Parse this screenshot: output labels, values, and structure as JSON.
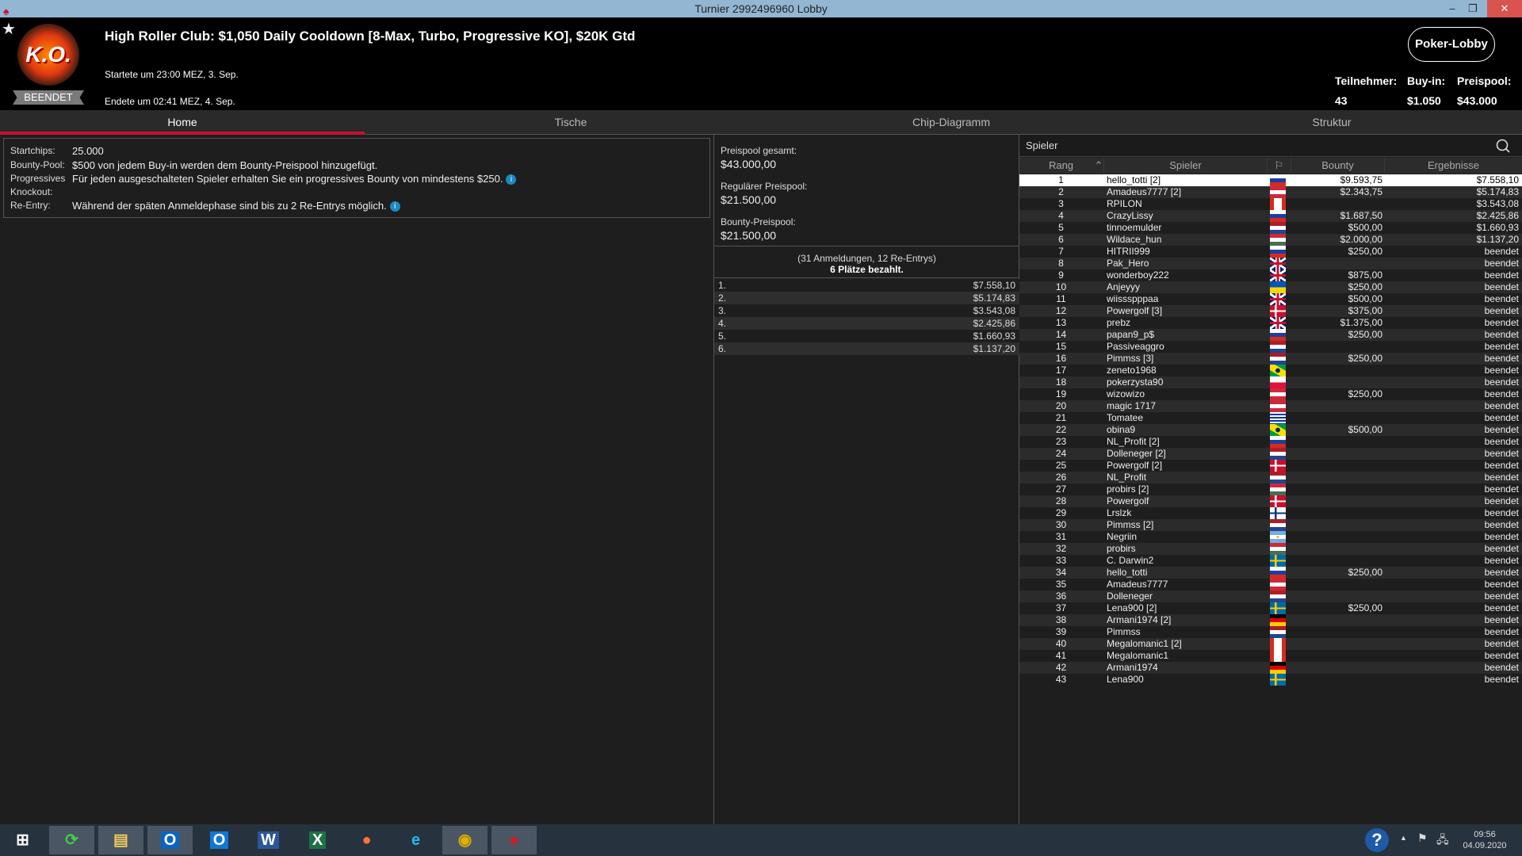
{
  "window": {
    "title": "Turnier 2992496960 Lobby",
    "minimize": "–",
    "restore": "❐",
    "close": "✕"
  },
  "header": {
    "logo_text": "K.O.",
    "status_badge": "BEENDET",
    "title": "High Roller Club: $1,050 Daily Cooldown [8-Max, Turbo, Progressive KO], $20K Gtd",
    "started": "Startete um 23:00 MEZ, 3. Sep.",
    "ended": "Endete um 02:41 MEZ, 4. Sep.",
    "lobby_button": "Poker-Lobby",
    "stats": [
      {
        "label": "Teilnehmer:",
        "value": "43"
      },
      {
        "label": "Buy-in:",
        "value": "$1.050"
      },
      {
        "label": "Preispool:",
        "value": "$43.000"
      }
    ]
  },
  "tabs": [
    "Home",
    "Tische",
    "Chip-Diagramm",
    "Struktur"
  ],
  "info": [
    {
      "k": "Startchips:",
      "v": "25.000"
    },
    {
      "k": "Bounty-Pool:",
      "v": "$500 von jedem Buy-in werden dem Bounty-Preispool hinzugefügt."
    },
    {
      "k": "Progressives",
      "v": "Für jeden ausgeschalteten Spieler erhalten Sie ein progressives Bounty von mindestens $250."
    },
    {
      "k": "Knockout:",
      "v": ""
    },
    {
      "k": "Re-Entry:",
      "v": "Während der späten Anmeldephase sind bis zu 2 Re-Entrys möglich."
    }
  ],
  "prizepool": {
    "total_label": "Preispool gesamt:",
    "total": "$43.000,00",
    "regular_label": "Regulärer Preispool:",
    "regular": "$21.500,00",
    "bounty_label": "Bounty-Preispool:",
    "bounty": "$21.500,00",
    "entries": "(31 Anmeldungen, 12 Re-Entrys)",
    "paid": "6 Plätze bezahlt.",
    "payouts": [
      [
        "1.",
        "$7.558,10"
      ],
      [
        "2.",
        "$5.174,83"
      ],
      [
        "3.",
        "$3.543,08"
      ],
      [
        "4.",
        "$2.425,86"
      ],
      [
        "5.",
        "$1.660,93"
      ],
      [
        "6.",
        "$1.137,20"
      ]
    ]
  },
  "players": {
    "search_label": "Spieler",
    "columns": [
      "Rang",
      "Spieler",
      "Bounty",
      "Ergebnisse"
    ],
    "rows": [
      [
        "1",
        "hello_totti [2]",
        "ru",
        "$9.593,75",
        "$7.558,10"
      ],
      [
        "2",
        "Amadeus7777 [2]",
        "at",
        "$2.343,75",
        "$5.174,83"
      ],
      [
        "3",
        "RPILON",
        "ca",
        "",
        "$3.543,08"
      ],
      [
        "4",
        "CrazyLissy",
        "ru",
        "$1.687,50",
        "$2.425,86"
      ],
      [
        "5",
        "tinnoemulder",
        "nl",
        "$500,00",
        "$1.660,93"
      ],
      [
        "6",
        "Wildace_hun",
        "hu",
        "$2.000,00",
        "$1.137,20"
      ],
      [
        "7",
        "HITRII999",
        "ru",
        "$250,00",
        "beendet"
      ],
      [
        "8",
        "Pak_Hero",
        "gb",
        "",
        "beendet"
      ],
      [
        "9",
        "wonderboy222",
        "gb",
        "$875,00",
        "beendet"
      ],
      [
        "10",
        "Anjeyyy",
        "ua",
        "$250,00",
        "beendet"
      ],
      [
        "11",
        "wiissspppaa",
        "gb",
        "$500,00",
        "beendet"
      ],
      [
        "12",
        "Powergolf [3]",
        "dk",
        "$375,00",
        "beendet"
      ],
      [
        "13",
        "prebz",
        "gb",
        "$1.375,00",
        "beendet"
      ],
      [
        "14",
        "papan9_p$",
        "ru",
        "$250,00",
        "beendet"
      ],
      [
        "15",
        "Passiveaggro",
        "nl",
        "",
        "beendet"
      ],
      [
        "16",
        "Pimmss [3]",
        "nl",
        "$250,00",
        "beendet"
      ],
      [
        "17",
        "zeneto1968",
        "br",
        "",
        "beendet"
      ],
      [
        "18",
        "pokerzysta90",
        "pl",
        "",
        "beendet"
      ],
      [
        "19",
        "wizowizo",
        "at",
        "$250,00",
        "beendet"
      ],
      [
        "20",
        "magic 1717",
        "at",
        "",
        "beendet"
      ],
      [
        "21",
        "Tomatee",
        "uy",
        "",
        "beendet"
      ],
      [
        "22",
        "obina9",
        "br",
        "$500,00",
        "beendet"
      ],
      [
        "23",
        "NL_Profit [2]",
        "ru",
        "",
        "beendet"
      ],
      [
        "24",
        "Dolleneger [2]",
        "nl",
        "",
        "beendet"
      ],
      [
        "25",
        "Powergolf [2]",
        "dk",
        "",
        "beendet"
      ],
      [
        "26",
        "NL_Profit",
        "nl",
        "",
        "beendet"
      ],
      [
        "27",
        "probirs [2]",
        "hu",
        "",
        "beendet"
      ],
      [
        "28",
        "Powergolf",
        "dk",
        "",
        "beendet"
      ],
      [
        "29",
        "Lrslzk",
        "fi",
        "",
        "beendet"
      ],
      [
        "30",
        "Pimmss [2]",
        "nl",
        "",
        "beendet"
      ],
      [
        "31",
        "Negriin",
        "ar",
        "",
        "beendet"
      ],
      [
        "32",
        "probirs",
        "hu",
        "",
        "beendet"
      ],
      [
        "33",
        "C. Darwin2",
        "se",
        "",
        "beendet"
      ],
      [
        "34",
        "hello_totti",
        "ru",
        "$250,00",
        "beendet"
      ],
      [
        "35",
        "Amadeus7777",
        "at",
        "",
        "beendet"
      ],
      [
        "36",
        "Dolleneger",
        "nl",
        "",
        "beendet"
      ],
      [
        "37",
        "Lena900 [2]",
        "se",
        "$250,00",
        "beendet"
      ],
      [
        "38",
        "Armani1974 [2]",
        "de",
        "",
        "beendet"
      ],
      [
        "39",
        "Pimmss",
        "nl",
        "",
        "beendet"
      ],
      [
        "40",
        "Megalomanic1 [2]",
        "ca",
        "",
        "beendet"
      ],
      [
        "41",
        "Megalomanic1",
        "ca",
        "",
        "beendet"
      ],
      [
        "42",
        "Armani1974",
        "de",
        "",
        "beendet"
      ],
      [
        "43",
        "Lena900",
        "se",
        "",
        "beendet"
      ]
    ]
  },
  "taskbar": {
    "apps": [
      "windows-start",
      "sync-app",
      "file-explorer",
      "outlook",
      "outlook-new",
      "word",
      "excel",
      "firefox",
      "internet-explorer",
      "chrome",
      "pokerstars"
    ],
    "time": "09:56",
    "date": "04.09.2020"
  }
}
